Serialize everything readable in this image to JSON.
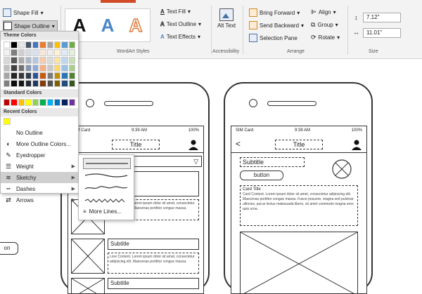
{
  "ribbon": {
    "shape_fill": "Shape Fill",
    "shape_outline": "Shape Outline",
    "wordart_letter": "A",
    "text_fill": "Text Fill",
    "text_outline": "Text Outline",
    "text_effects": "Text Effects",
    "alt_text": "Alt Text",
    "bring_forward": "Bring Forward",
    "send_backward": "Send Backward",
    "selection_pane": "Selection Pane",
    "align": "Align",
    "group": "Group",
    "rotate": "Rotate",
    "height": "7.12\"",
    "width": "11.01\"",
    "groups": {
      "wordart_styles": "WordArt Styles",
      "accessibility": "Accessibility",
      "arrange": "Arrange",
      "size": "Size"
    },
    "colors": {
      "accent_tab": "#d04b26"
    }
  },
  "menu": {
    "theme_colors_header": "Theme Colors",
    "standard_colors_header": "Standard Colors",
    "recent_colors_header": "Recent Colors",
    "no_outline": "No Outline",
    "more_outline_colors": "More Outline Colors...",
    "eyedropper": "Eyedropper",
    "weight": "Weight",
    "sketchy": "Sketchy",
    "dashes": "Dashes",
    "arrows": "Arrows",
    "theme_colors": [
      [
        "#ffffff",
        "#000000",
        "#e7e6e6",
        "#44546a",
        "#4472c4",
        "#ed7d31",
        "#a5a5a5",
        "#ffc000",
        "#5b9bd5",
        "#70ad47"
      ],
      [
        "#f2f2f2",
        "#7f7f7f",
        "#d0cece",
        "#d6dce4",
        "#d9e2f3",
        "#fbe5d5",
        "#ededed",
        "#fff2cc",
        "#deebf6",
        "#e2efd9"
      ],
      [
        "#d8d8d8",
        "#595959",
        "#aeabab",
        "#adb9ca",
        "#b4c6e7",
        "#f7cbac",
        "#dbdbdb",
        "#fee599",
        "#bdd7ee",
        "#c5e0b3"
      ],
      [
        "#bfbfbf",
        "#3f3f3f",
        "#757070",
        "#8496b0",
        "#8eaadb",
        "#f4b183",
        "#c9c9c9",
        "#ffd965",
        "#9cc3e5",
        "#a8d08d"
      ],
      [
        "#a5a5a5",
        "#262626",
        "#3a3838",
        "#323f4f",
        "#2f5496",
        "#c55a11",
        "#7b7b7b",
        "#bf9000",
        "#2e75b5",
        "#538135"
      ],
      [
        "#7f7f7f",
        "#0c0c0c",
        "#171616",
        "#222a35",
        "#1f3864",
        "#833c0b",
        "#525252",
        "#7f6000",
        "#1e4e79",
        "#375623"
      ]
    ],
    "standard_colors": [
      "#c00000",
      "#ff0000",
      "#ffc000",
      "#ffff00",
      "#92d050",
      "#00b050",
      "#00b0f0",
      "#0070c0",
      "#002060",
      "#7030a0"
    ],
    "recent_colors": [
      "#ffff00"
    ]
  },
  "submenu": {
    "more_lines": "More Lines..."
  },
  "left_phone": {
    "sim": "SIM Card",
    "time": "9:39 AM",
    "battery": "100%",
    "title": "Title",
    "subtitle1": "Subtitle",
    "subtitle2": "Subtitle",
    "subtitle3": "Subtitle",
    "lorem": "Lore Content. Lorem ipsum dolor sit amet, consectetur adipiscing elit. Maecenas porttitor congue massa."
  },
  "right_phone": {
    "sim": "SIM Card",
    "time": "9:39 AM",
    "battery": "100%",
    "back": "<",
    "title": "Title",
    "subtitle": "Subtitle",
    "button": "button",
    "card_title": "Card Title",
    "card_text": "Card Content. Lorem ipsum dolor sit amet, consectetur adipiscing elit. Maecenas porttitor congue massa. Fusce posuere, magna sed pulvinar ultricies, purus lectus malesuada libero, sit amet commodo magna eros quis urna."
  },
  "far_left": {
    "button": "on"
  }
}
